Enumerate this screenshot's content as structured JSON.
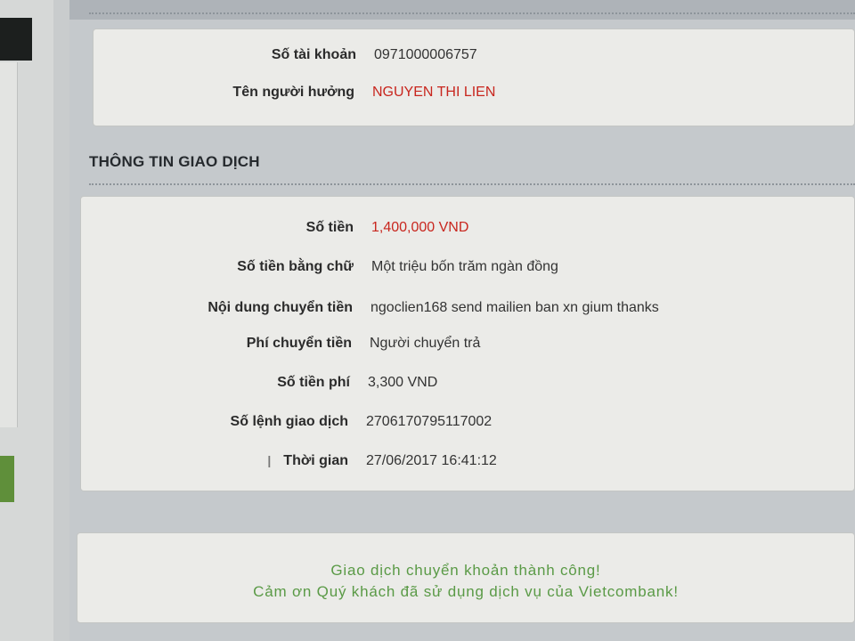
{
  "beneficiary": {
    "account_label": "Số tài khoản",
    "account_value": "0971000006757",
    "name_label": "Tên người hưởng",
    "name_value": "NGUYEN THI LIEN"
  },
  "transaction": {
    "section_title": "THÔNG TIN GIAO DỊCH",
    "rows": [
      {
        "label": "Số tiền",
        "value": "1,400,000 VND"
      },
      {
        "label": "Số tiền bằng chữ",
        "value": "Một triệu bốn trăm ngàn đồng"
      },
      {
        "label": "Nội dung chuyển tiền",
        "value": "ngoclien168 send mailien ban xn gium thanks"
      },
      {
        "label": "Phí chuyển tiền",
        "value": "Người chuyển trả"
      },
      {
        "label": "Số tiền phí",
        "value": "3,300 VND"
      },
      {
        "label": "Số lệnh giao dịch",
        "value": "2706170795117002"
      },
      {
        "label": "Thời gian",
        "value": "27/06/2017 16:41:12"
      }
    ]
  },
  "result": {
    "line1": "Giao dịch chuyển khoản thành công!",
    "line2": "Cảm ơn Quý khách đã sử dụng dịch vụ của Vietcombank!"
  },
  "colors": {
    "amount_red": "#c8261e",
    "success_green": "#5a9a46"
  }
}
